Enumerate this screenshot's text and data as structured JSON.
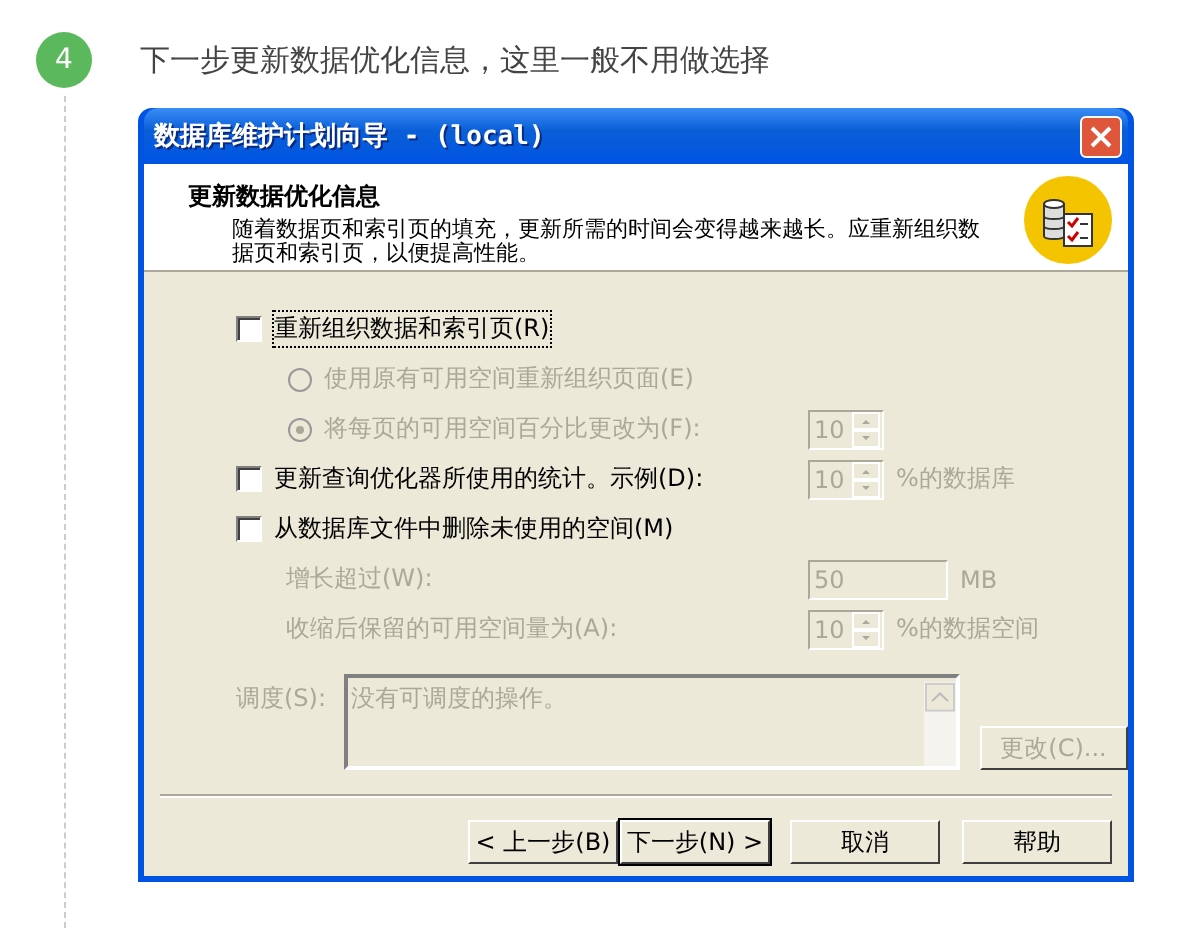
{
  "step": {
    "number": "4",
    "text": "下一步更新数据优化信息，这里一般不用做选择"
  },
  "dialog": {
    "title": "数据库维护计划向导 - (local)",
    "header": {
      "title": "更新数据优化信息",
      "description": "随着数据页和索引页的填充，更新所需的时间会变得越来越长。应重新组织数据页和索引页，以便提高性能。"
    },
    "options": [
      {
        "kind": "checkbox",
        "label": "重新组织数据和索引页(R)",
        "checked": false,
        "disabled": false,
        "focused": true
      },
      {
        "kind": "radio",
        "label": "使用原有可用空间重新组织页面(E)",
        "selected": false,
        "disabled": true
      },
      {
        "kind": "radio",
        "label": "将每页的可用空间百分比更改为(F):",
        "selected": true,
        "disabled": true,
        "control": {
          "kind": "spinner",
          "value": "10",
          "disabled": true
        }
      },
      {
        "kind": "checkbox",
        "label": "更新查询优化器所使用的统计。示例(D):",
        "checked": false,
        "disabled": false,
        "focused": false,
        "control": {
          "kind": "spinner",
          "value": "10",
          "disabled": true
        },
        "suffix": "%的数据库"
      },
      {
        "kind": "checkbox",
        "label": "从数据库文件中删除未使用的空间(M)",
        "checked": false,
        "disabled": false,
        "focused": false
      },
      {
        "kind": "field",
        "label": "增长超过(W):",
        "disabled": true,
        "control": {
          "kind": "input",
          "value": "50",
          "disabled": true
        },
        "suffix": "MB"
      },
      {
        "kind": "field",
        "label": "收缩后保留的可用空间量为(A):",
        "disabled": true,
        "control": {
          "kind": "spinner",
          "value": "10",
          "disabled": true
        },
        "suffix": "%的数据空间"
      }
    ],
    "schedule": {
      "label": "调度(S):",
      "text": "没有可调度的操作。",
      "disabled": true
    },
    "change_button": {
      "label": "更改(C)...",
      "disabled": true
    },
    "buttons": [
      {
        "label": "< 上一步(B)",
        "default": false
      },
      {
        "label": "下一步(N) >",
        "default": true
      },
      {
        "label": "取消",
        "default": false
      },
      {
        "label": "帮助",
        "default": false
      }
    ]
  }
}
